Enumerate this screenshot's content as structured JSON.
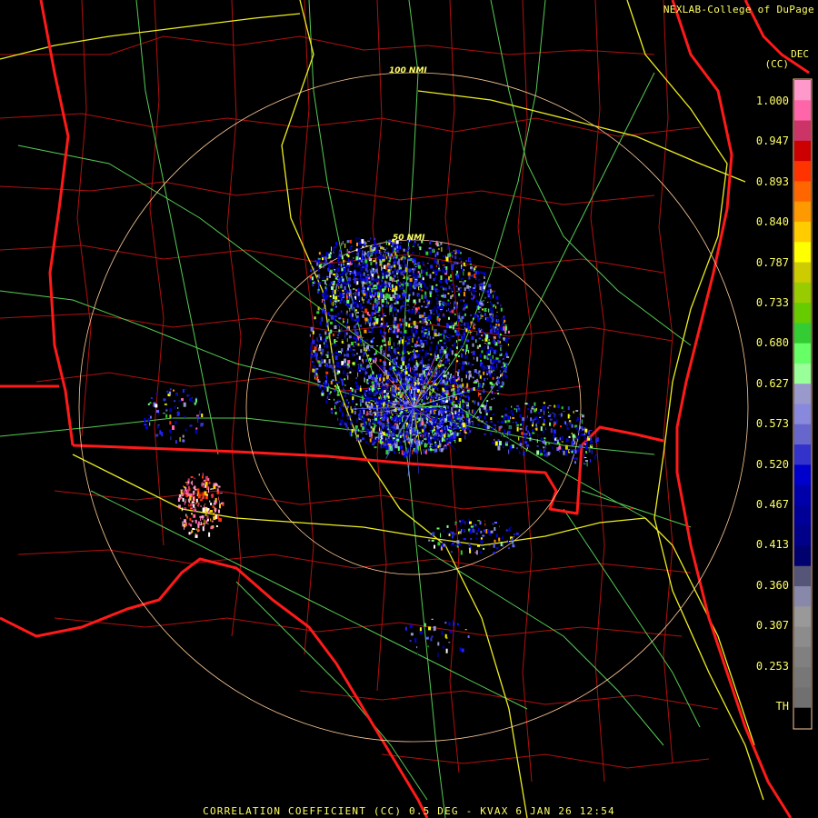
{
  "header": {
    "credit": "NEXLAB-College of DuPage"
  },
  "legend": {
    "unit_line1": "DEC",
    "unit_line2": "(CC)",
    "labels": [
      "1.000",
      "0.947",
      "0.893",
      "0.840",
      "0.787",
      "0.733",
      "0.680",
      "0.627",
      "0.573",
      "0.520",
      "0.467",
      "0.413",
      "0.360",
      "0.307",
      "0.253",
      "TH"
    ],
    "colors": [
      "#ff99cc",
      "#ff66aa",
      "#cc3366",
      "#cc0000",
      "#ff3300",
      "#ff6600",
      "#ff9900",
      "#ffcc00",
      "#ffff00",
      "#cccc00",
      "#99cc00",
      "#66cc00",
      "#33cc33",
      "#66ff66",
      "#99ff99",
      "#9999cc",
      "#8888dd",
      "#6666cc",
      "#3333cc",
      "#0000cc",
      "#0000aa",
      "#000099",
      "#000088",
      "#00006e",
      "#555577",
      "#8888aa",
      "#999999",
      "#8c8c8c",
      "#808080",
      "#777777",
      "#707070",
      "#000000"
    ]
  },
  "range_rings": [
    "100 NMI",
    "50 NMI"
  ],
  "footer": {
    "product": "CORRELATION COEFFICIENT (CC) 0.5 DEG - KVAX 6 JAN 26 12:54"
  },
  "colors": {
    "state_border": "#ff1a1a",
    "county_border": "#cc1010",
    "highway": "#ffff33",
    "road": "#66dd66",
    "ring": "#ffcc99",
    "text": "#ffff66"
  }
}
